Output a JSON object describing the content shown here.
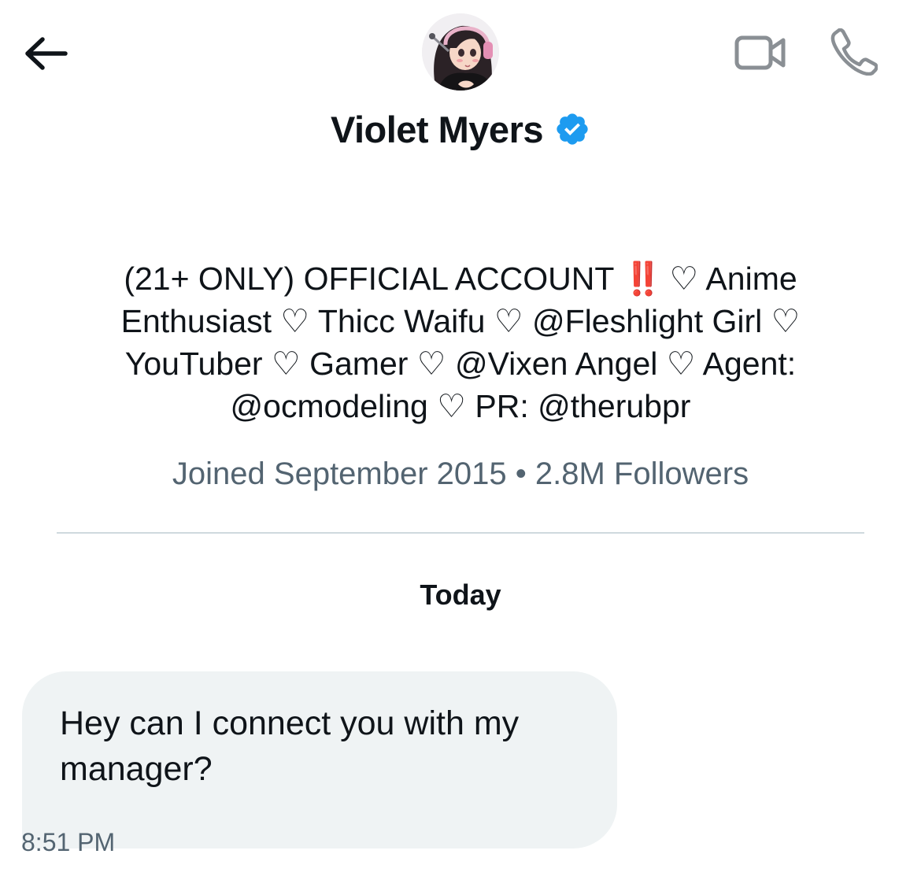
{
  "header": {
    "back_icon": "arrow-left-icon",
    "video_icon": "video-camera-icon",
    "phone_icon": "phone-icon",
    "avatar_alt": "profile avatar"
  },
  "profile": {
    "display_name": "Violet Myers",
    "verified_icon": "verified-badge-icon",
    "verified_color": "#1d9bf0",
    "bio_prefix": "(21+ ONLY) OFFICIAL ACCOUNT ",
    "bio_alert": "‼️",
    "bio_rest": " ♡ Anime Enthusiast ♡ Thicc Waifu ♡ @Fleshlight Girl ♡ YouTuber ♡ Gamer ♡ @Vixen Angel ♡ Agent: @ocmodeling ♡ PR: @therubpr",
    "meta": "Joined September 2015 • 2.8M Followers"
  },
  "conversation": {
    "date_label": "Today",
    "messages": [
      {
        "text": "Hey can I connect you with my manager?",
        "time": "8:51 PM"
      }
    ]
  },
  "colors": {
    "text_primary": "#0f1419",
    "text_secondary": "#536471",
    "bubble_background": "#eff3f4",
    "divider": "#cfd9de",
    "icon_gray": "#8a8f94",
    "alert_red": "#e0245e"
  }
}
